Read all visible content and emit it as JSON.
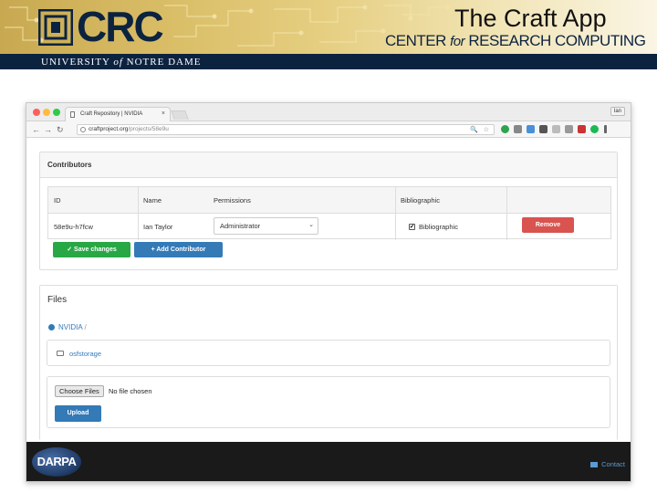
{
  "slide": {
    "title": "The Craft App",
    "crc_acronym": "CRC",
    "center_name_pre": "CENTER ",
    "center_name_for": "for",
    "center_name_post": " RESEARCH COMPUTING",
    "university_pre": "UNIVERSITY ",
    "university_of": "of",
    "university_post": " NOTRE DAME",
    "colors": {
      "gold": "#c8a951",
      "navy": "#0c2340"
    }
  },
  "browser": {
    "tab_title": "Craft Repository | NVIDIA",
    "tab_close": "×",
    "user_badge": "Ian",
    "url_host": "craftproject.org",
    "url_path": "/projects/58e9u",
    "nav": {
      "back": "←",
      "forward": "→",
      "reload": "↻"
    },
    "omnibox_icons": "🔍 ☆"
  },
  "contributors": {
    "heading": "Contributors",
    "columns": [
      "ID",
      "Name",
      "Permissions",
      "Bibliographic"
    ],
    "row": {
      "id": "58e9u-h7fcw",
      "name": "Ian Taylor",
      "permission": "Administrator",
      "bibliographic_checked": true,
      "bibliographic_label": "Bibliographic",
      "remove_label": "Remove"
    },
    "save_label": "✓  Save changes",
    "add_label": "+  Add Contributor"
  },
  "files": {
    "heading": "Files",
    "breadcrumb_project": "NVIDIA",
    "breadcrumb_sep": "/",
    "storage_name": "osfstorage",
    "choose_label": "Choose Files",
    "no_file_label": "No file chosen",
    "upload_label": "Upload"
  },
  "footer": {
    "logo_text": "DARPA",
    "contact_label": "Contact"
  }
}
